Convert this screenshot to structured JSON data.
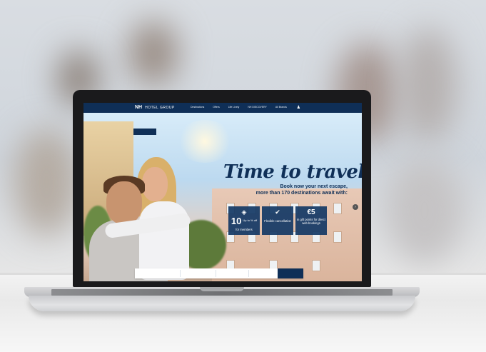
{
  "site": {
    "logo_mark": "NH",
    "logo_text": "HOTEL GROUP",
    "nav": [
      "Destinations",
      "Offers",
      "Life Lively",
      "NH DISCOVERY",
      "All Brands"
    ],
    "nav_badge": "DISCOVERY",
    "cta_label": "",
    "headline": "Time to travel!",
    "subline_1": "Book now your next escape,",
    "subline_2": "more than 170 destinations await with:",
    "features": [
      {
        "icon": "tag-icon",
        "big": "10",
        "small": "Up to % off",
        "text": "for members"
      },
      {
        "icon": "check-icon",
        "text": "Flexible cancellation"
      },
      {
        "big": "€5",
        "text": "in gift points for direct web bookings"
      }
    ],
    "search": {
      "destination": "",
      "dates": "",
      "guests": "",
      "promo": "",
      "button": ""
    }
  }
}
